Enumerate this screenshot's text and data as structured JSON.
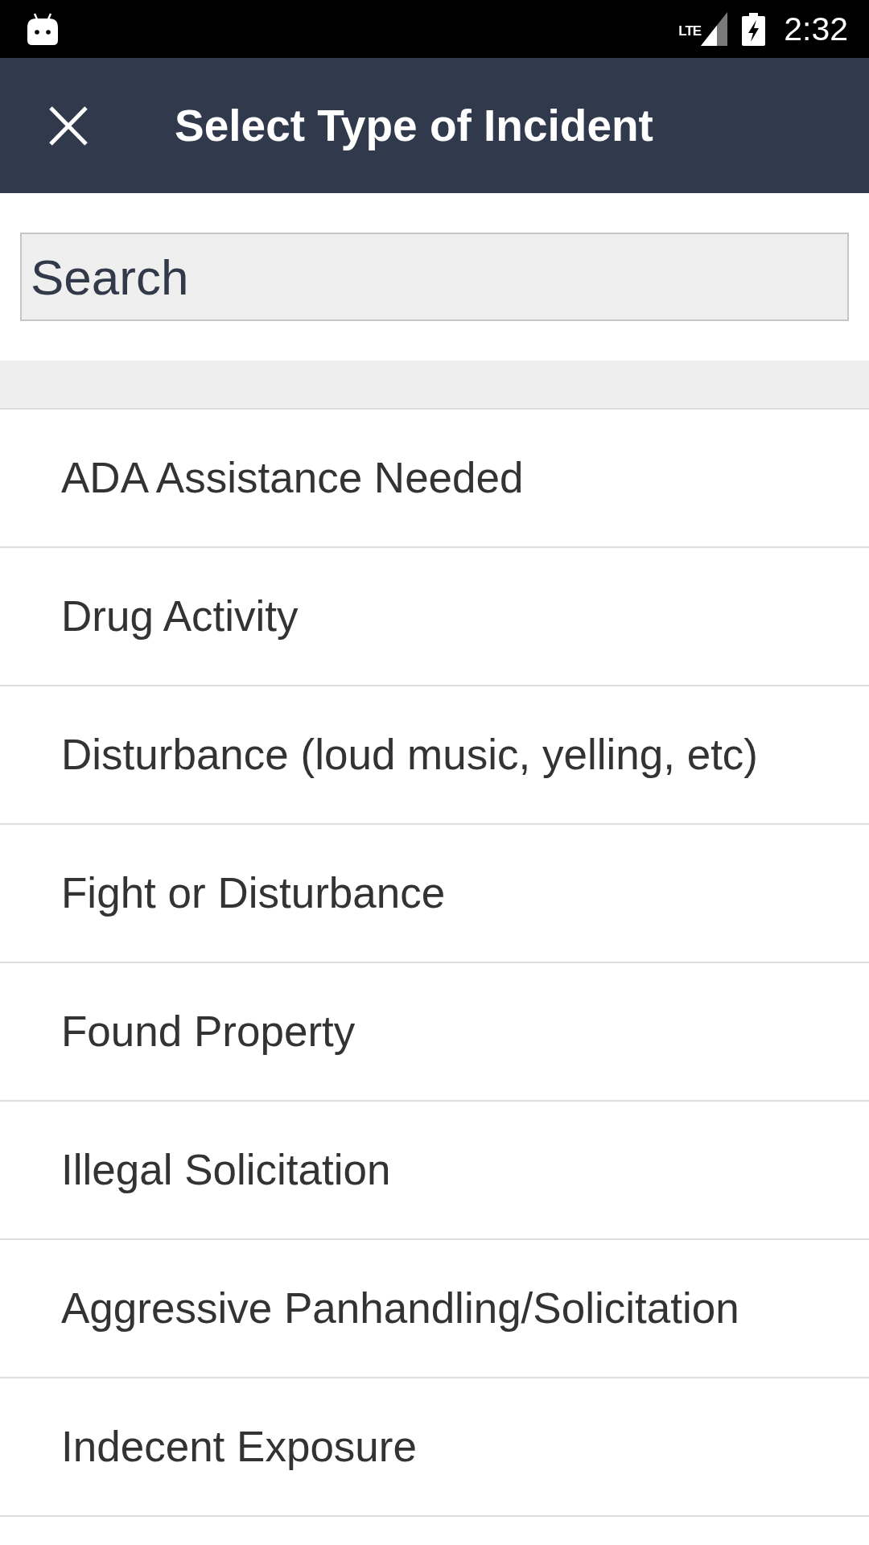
{
  "status_bar": {
    "network_type": "LTE",
    "time": "2:32"
  },
  "app_bar": {
    "title": "Select Type of Incident"
  },
  "search": {
    "placeholder": "Search"
  },
  "incident_types": [
    {
      "label": "ADA Assistance Needed",
      "selected": false
    },
    {
      "label": "Drug Activity",
      "selected": false
    },
    {
      "label": "Disturbance (loud music, yelling, etc)",
      "selected": false
    },
    {
      "label": "Fight or Disturbance",
      "selected": false
    },
    {
      "label": "Found Property",
      "selected": false
    },
    {
      "label": "Illegal Solicitation",
      "selected": false
    },
    {
      "label": "Aggressive Panhandling/Solicitation",
      "selected": false
    },
    {
      "label": "Indecent Exposure",
      "selected": false
    }
  ]
}
